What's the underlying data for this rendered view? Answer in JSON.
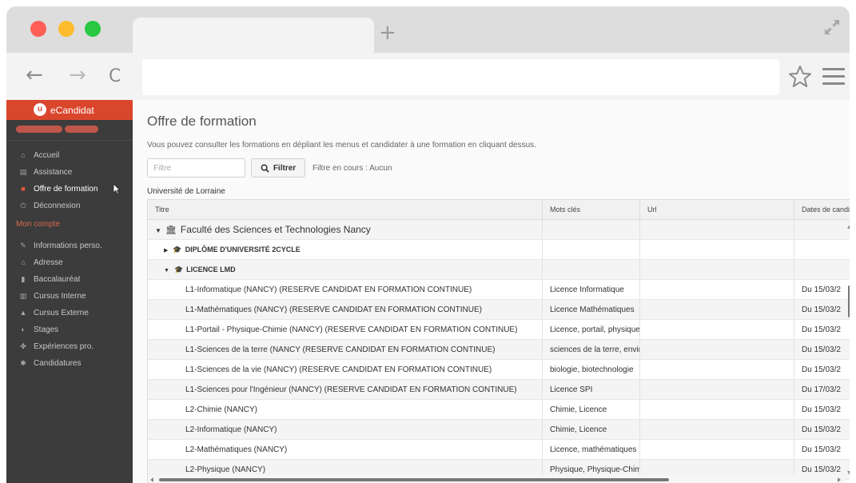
{
  "browser": {
    "colors": {
      "red": "#fd5f57",
      "yellow": "#fdbc2e",
      "green": "#28c840"
    },
    "new_tab": "+",
    "nav": {
      "back": "←",
      "forward": "→",
      "reload": "C"
    }
  },
  "sidebar": {
    "brand": "eCandidat",
    "items": [
      {
        "label": "Accueil",
        "icon": "home-icon",
        "glyph": "⌂"
      },
      {
        "label": "Assistance",
        "icon": "help-icon",
        "glyph": "▤"
      },
      {
        "label": "Offre de formation",
        "icon": "bookmark-icon",
        "glyph": "■",
        "active": true
      },
      {
        "label": "Déconnexion",
        "icon": "power-icon",
        "glyph": "⏻"
      }
    ],
    "account_title": "Mon compte",
    "account_items": [
      {
        "label": "Informations perso.",
        "icon": "pencil-icon",
        "glyph": "✎"
      },
      {
        "label": "Adresse",
        "icon": "home-icon",
        "glyph": "⌂"
      },
      {
        "label": "Baccalauréat",
        "icon": "book-icon",
        "glyph": "▮"
      },
      {
        "label": "Cursus Interne",
        "icon": "institution-icon",
        "glyph": "▥"
      },
      {
        "label": "Cursus Externe",
        "icon": "graduation-cap-icon",
        "glyph": "▲"
      },
      {
        "label": "Stages",
        "icon": "stage-icon",
        "glyph": "◐"
      },
      {
        "label": "Expériences pro.",
        "icon": "people-icon",
        "glyph": "✤"
      },
      {
        "label": "Candidatures",
        "icon": "asterisk-icon",
        "glyph": "✱"
      }
    ]
  },
  "main": {
    "title": "Offre de formation",
    "description": "Vous pouvez consulter les formations en dépliant les menus et candidater à une formation en cliquant dessus.",
    "filter_placeholder": "Filtre",
    "filter_button": "Filtrer",
    "filter_status": "Filtre en cours : Aucun",
    "university": "Université de Lorraine",
    "columns": [
      "Titre",
      "Mots clés",
      "Url",
      "Dates de candi"
    ],
    "rows": [
      {
        "type": "faculty",
        "arrow": "▼",
        "title": "Faculté des Sciences et Technologies Nancy",
        "keywords": "",
        "url": "",
        "dates": ""
      },
      {
        "type": "group",
        "arrow": "▶",
        "title": "DIPLÔME D'UNIVERSITÉ 2CYCLE",
        "keywords": "",
        "url": "",
        "dates": ""
      },
      {
        "type": "group",
        "arrow": "▼",
        "title": "LICENCE LMD",
        "keywords": "",
        "url": "",
        "dates": ""
      },
      {
        "type": "leaf",
        "title": "L1-Informatique (NANCY) (RESERVE CANDIDAT EN FORMATION CONTINUE)",
        "keywords": "Licence Informatique",
        "url": "",
        "dates": "Du 15/03/2"
      },
      {
        "type": "leaf",
        "title": "L1-Mathématiques (NANCY) (RESERVE CANDIDAT EN FORMATION CONTINUE)",
        "keywords": "Licence Mathématiques",
        "url": "",
        "dates": "Du 15/03/2"
      },
      {
        "type": "leaf",
        "title": "L1-Portail - Physique-Chimie (NANCY) (RESERVE CANDIDAT EN FORMATION CONTINUE)",
        "keywords": "Licence, portail, physique",
        "url": "",
        "dates": "Du 15/03/2"
      },
      {
        "type": "leaf",
        "title": "L1-Sciences de la terre (NANCY (RESERVE CANDIDAT EN FORMATION CONTINUE)",
        "keywords": "sciences de la terre, environnement",
        "url": "",
        "dates": "Du 15/03/2"
      },
      {
        "type": "leaf",
        "title": "L1-Sciences de la vie (NANCY) (RESERVE CANDIDAT EN FORMATION CONTINUE)",
        "keywords": "biologie, biotechnologie",
        "url": "",
        "dates": "Du 15/03/2"
      },
      {
        "type": "leaf",
        "title": "L1-Sciences pour l'Ingénieur (NANCY) (RESERVE CANDIDAT EN FORMATION CONTINUE)",
        "keywords": "Licence SPI",
        "url": "",
        "dates": "Du 17/03/2"
      },
      {
        "type": "leaf",
        "title": "L2-Chimie (NANCY)",
        "keywords": "Chimie, Licence",
        "url": "",
        "dates": "Du 15/03/2"
      },
      {
        "type": "leaf",
        "title": "L2-Informatique (NANCY)",
        "keywords": "Chimie, Licence",
        "url": "",
        "dates": "Du 15/03/2"
      },
      {
        "type": "leaf",
        "title": "L2-Mathématiques (NANCY)",
        "keywords": "Licence, mathématiques",
        "url": "",
        "dates": "Du 15/03/2"
      },
      {
        "type": "leaf",
        "title": "L2-Physique (NANCY)",
        "keywords": "Physique, Physique-Chimie",
        "url": "",
        "dates": "Du 15/03/2"
      }
    ]
  }
}
